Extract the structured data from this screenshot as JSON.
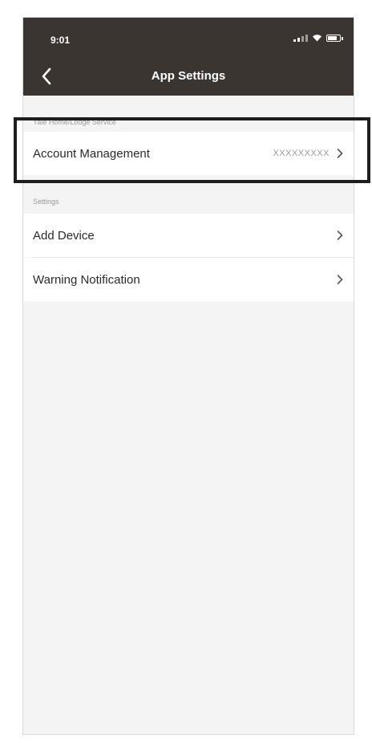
{
  "status_bar": {
    "time": "9:01",
    "icons": [
      "cellular-signal-icon",
      "wifi-icon",
      "battery-icon"
    ]
  },
  "nav": {
    "back_icon": "chevron-left-icon",
    "title": "App Settings"
  },
  "sections": [
    {
      "header": "Yale Home/Lodge Service",
      "items": [
        {
          "label": "Account Management",
          "value": "XXXXXXXXX"
        }
      ]
    },
    {
      "header": "Settings",
      "items": [
        {
          "label": "Add Device",
          "value": ""
        },
        {
          "label": "Warning Notification",
          "value": ""
        }
      ]
    }
  ],
  "colors": {
    "top_bar": "#3b3532",
    "background": "#f4f4f4",
    "row_background": "#ffffff",
    "highlight_border": "#1e1e1e"
  }
}
